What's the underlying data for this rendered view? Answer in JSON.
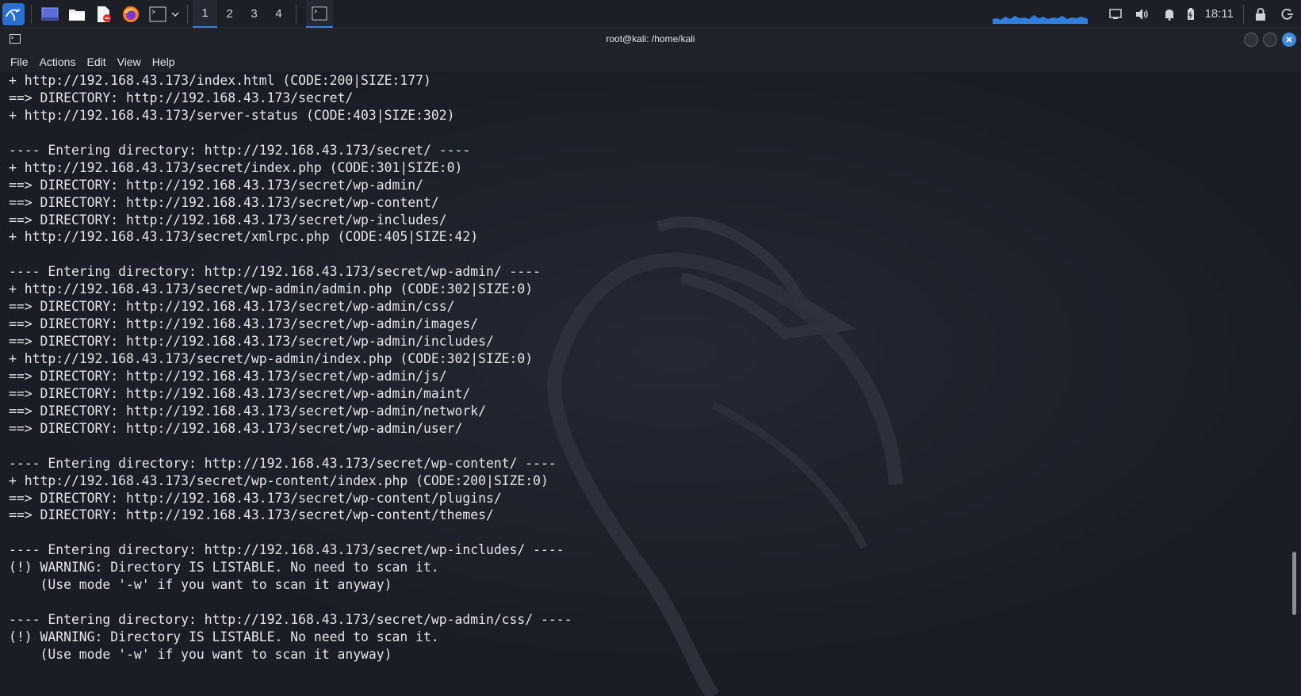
{
  "taskbar": {
    "workspaces": [
      "1",
      "2",
      "3",
      "4"
    ],
    "active_workspace": "1",
    "clock": "18:11",
    "icons": [
      "kali-menu-icon",
      "desktop-icon",
      "file-manager-icon",
      "text-editor-icon",
      "firefox-icon",
      "terminal-icon",
      "chevron-down-icon",
      "monitor-icon",
      "volume-icon",
      "bell-icon",
      "battery-icon",
      "lock-icon",
      "logout-icon"
    ]
  },
  "window": {
    "title": "root@kali: /home/kali"
  },
  "menu": {
    "file": "File",
    "actions": "Actions",
    "edit": "Edit",
    "view": "View",
    "help": "Help"
  },
  "terminal": {
    "lines": [
      "+ http://192.168.43.173/index.html (CODE:200|SIZE:177)",
      "==> DIRECTORY: http://192.168.43.173/secret/",
      "+ http://192.168.43.173/server-status (CODE:403|SIZE:302)",
      "",
      "---- Entering directory: http://192.168.43.173/secret/ ----",
      "+ http://192.168.43.173/secret/index.php (CODE:301|SIZE:0)",
      "==> DIRECTORY: http://192.168.43.173/secret/wp-admin/",
      "==> DIRECTORY: http://192.168.43.173/secret/wp-content/",
      "==> DIRECTORY: http://192.168.43.173/secret/wp-includes/",
      "+ http://192.168.43.173/secret/xmlrpc.php (CODE:405|SIZE:42)",
      "",
      "---- Entering directory: http://192.168.43.173/secret/wp-admin/ ----",
      "+ http://192.168.43.173/secret/wp-admin/admin.php (CODE:302|SIZE:0)",
      "==> DIRECTORY: http://192.168.43.173/secret/wp-admin/css/",
      "==> DIRECTORY: http://192.168.43.173/secret/wp-admin/images/",
      "==> DIRECTORY: http://192.168.43.173/secret/wp-admin/includes/",
      "+ http://192.168.43.173/secret/wp-admin/index.php (CODE:302|SIZE:0)",
      "==> DIRECTORY: http://192.168.43.173/secret/wp-admin/js/",
      "==> DIRECTORY: http://192.168.43.173/secret/wp-admin/maint/",
      "==> DIRECTORY: http://192.168.43.173/secret/wp-admin/network/",
      "==> DIRECTORY: http://192.168.43.173/secret/wp-admin/user/",
      "",
      "---- Entering directory: http://192.168.43.173/secret/wp-content/ ----",
      "+ http://192.168.43.173/secret/wp-content/index.php (CODE:200|SIZE:0)",
      "==> DIRECTORY: http://192.168.43.173/secret/wp-content/plugins/",
      "==> DIRECTORY: http://192.168.43.173/secret/wp-content/themes/",
      "",
      "---- Entering directory: http://192.168.43.173/secret/wp-includes/ ----",
      "(!) WARNING: Directory IS LISTABLE. No need to scan it.",
      "    (Use mode '-w' if you want to scan it anyway)",
      "",
      "---- Entering directory: http://192.168.43.173/secret/wp-admin/css/ ----",
      "(!) WARNING: Directory IS LISTABLE. No need to scan it.",
      "    (Use mode '-w' if you want to scan it anyway)"
    ]
  },
  "colors": {
    "accent": "#3d7fd8",
    "terminal_bg": "#1a1d25",
    "terminal_fg": "#e6e6e6"
  }
}
